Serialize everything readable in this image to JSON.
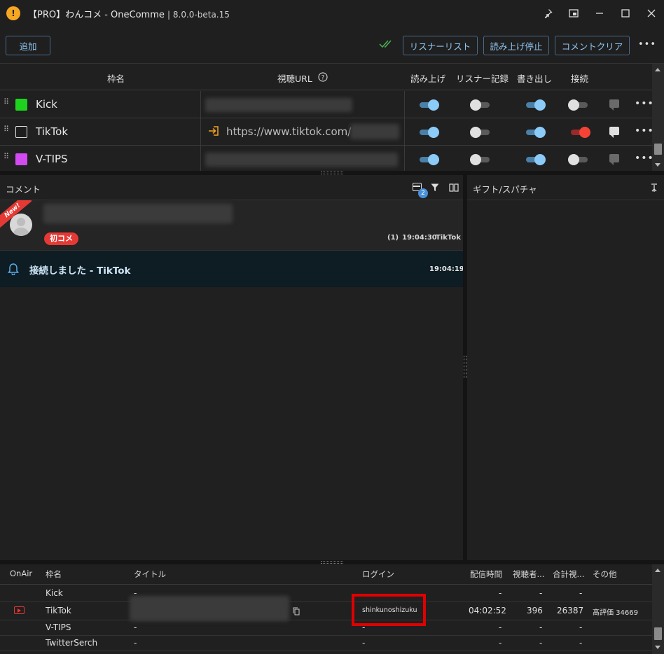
{
  "window": {
    "title": "【PRO】わんコメ - OneComme",
    "version": "| 8.0.0-beta.15",
    "logo_glyph": "!"
  },
  "toolbar": {
    "add_label": "追加",
    "listener_list_label": "リスナーリスト",
    "stop_reading_label": "読み上げ停止",
    "clear_comments_label": "コメントクリア",
    "more_label": "•••"
  },
  "stream_table": {
    "headers": {
      "name": "枠名",
      "url": "視聴URL",
      "read_aloud": "読み上げ",
      "listener_record": "リスナー記録",
      "write_out": "書き出し",
      "connect": "接続"
    },
    "rows": [
      {
        "name": "Kick",
        "color": "#1ed31e",
        "url": "",
        "read_aloud": true,
        "listener_record": false,
        "write_out": true,
        "connected": false
      },
      {
        "name": "TikTok",
        "color": "#1e1e1e",
        "url": "https://www.tiktok.com/",
        "read_aloud": true,
        "listener_record": false,
        "write_out": true,
        "connected": true
      },
      {
        "name": "V-TIPS",
        "color": "#d24bf0",
        "url": "",
        "read_aloud": true,
        "listener_record": false,
        "write_out": true,
        "connected": false
      }
    ]
  },
  "comment_pane": {
    "title": "コメント",
    "badge_count": "2",
    "comment": {
      "new_label": "New!",
      "first_badge": "初コメ",
      "count": "(1)",
      "time": "19:04:30",
      "service": "TikTok"
    },
    "system": {
      "text": "接続しました - TikTok",
      "time": "19:04:19"
    }
  },
  "gift_pane": {
    "title": "ギフト/スパチャ"
  },
  "bottom_table": {
    "headers": {
      "onair": "OnAir",
      "name": "枠名",
      "title": "タイトル",
      "login": "ログイン",
      "duration": "配信時間",
      "viewers": "視聴者...",
      "total_views": "合計視...",
      "other": "その他"
    },
    "rows": [
      {
        "name": "Kick",
        "title": "-",
        "login": "",
        "duration": "-",
        "viewers": "-",
        "total_views": "-",
        "other": ""
      },
      {
        "name": "TikTok",
        "title": "",
        "login": "shinkunoshizuku",
        "duration": "04:02:52",
        "viewers": "396",
        "total_views": "26387",
        "other": "高評価 34669"
      },
      {
        "name": "V-TIPS",
        "title": "-",
        "login": "-",
        "duration": "-",
        "viewers": "-",
        "total_views": "-",
        "other": ""
      },
      {
        "name": "TwitterSerch",
        "title": "-",
        "login": "-",
        "duration": "-",
        "viewers": "-",
        "total_views": "-",
        "other": ""
      }
    ]
  }
}
